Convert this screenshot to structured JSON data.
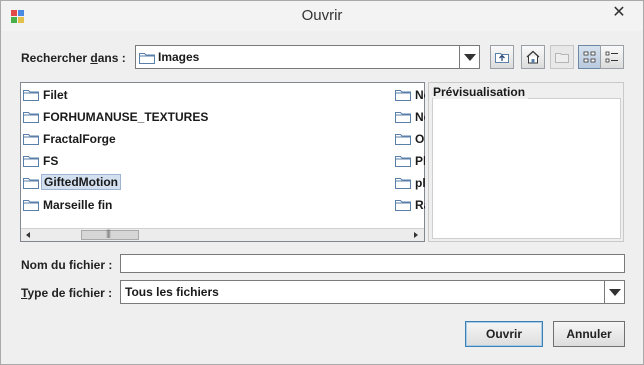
{
  "window": {
    "title": "Ouvrir",
    "close_symbol": "✕"
  },
  "look_in": {
    "label_prefix": "Rechercher ",
    "label_mnemonic": "d",
    "label_suffix": "ans :",
    "value": "Images"
  },
  "toolbar": {
    "buttons": [
      {
        "icon": "up-folder-icon"
      },
      {
        "icon": "home-icon"
      },
      {
        "icon": "new-folder-icon",
        "disabled": true
      },
      {
        "icon": "list-view-icon",
        "active": true
      },
      {
        "icon": "details-view-icon"
      }
    ]
  },
  "files": {
    "column1": [
      "Filet",
      "FORHUMANUSE_TEXTURES",
      "FractalForge",
      "FS",
      "GiftedMotion",
      "Marseille fin"
    ],
    "column2": [
      "Ne",
      "Ne",
      "Ol",
      "Pl",
      "pl",
      "Ra"
    ],
    "selected": "GiftedMotion"
  },
  "preview": {
    "title": "Prévisualisation"
  },
  "filename": {
    "label": "Nom du fichier :",
    "value": ""
  },
  "filetype": {
    "label_mnemonic": "T",
    "label_rest": "ype de fichier :",
    "value": "Tous les fichiers"
  },
  "buttons": {
    "open": "Ouvrir",
    "cancel": "Annuler"
  },
  "colors": {
    "selection": "#d3e0ef",
    "folder": "#5a7fa8"
  }
}
